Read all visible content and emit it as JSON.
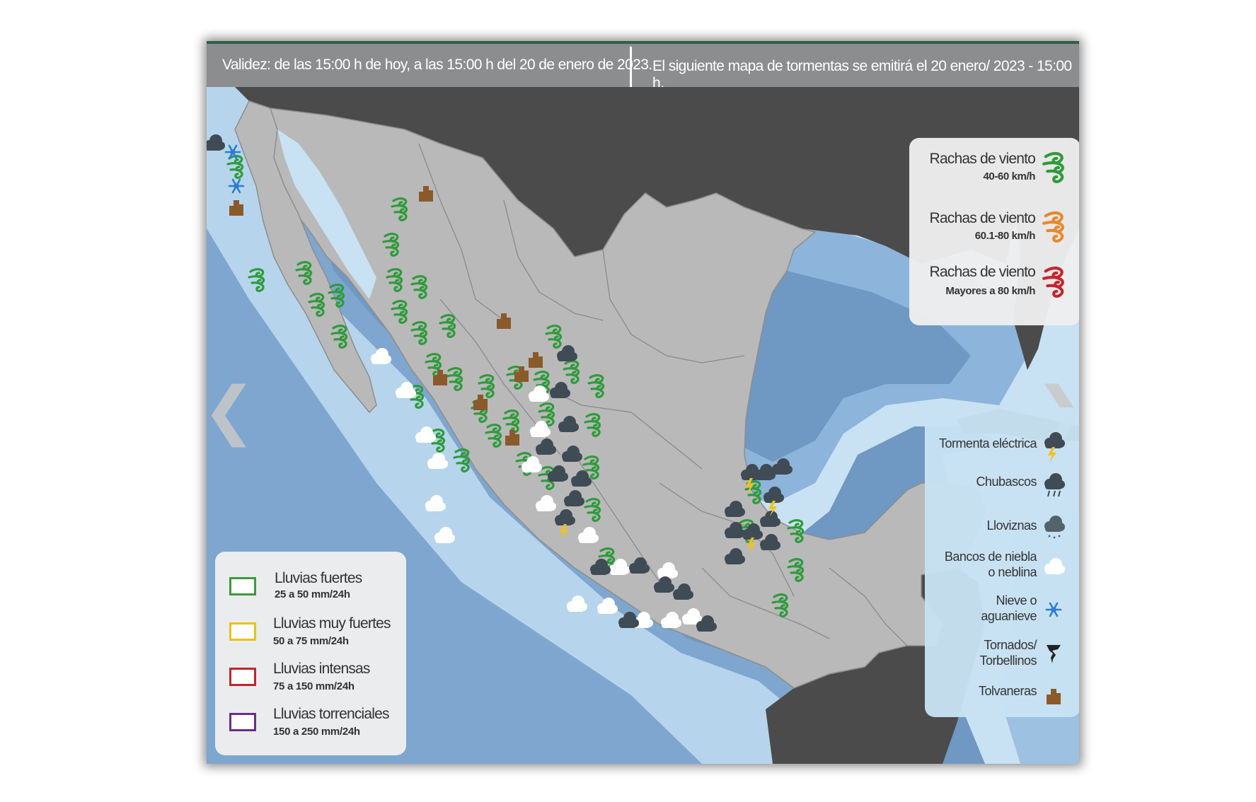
{
  "header": {
    "validity": "Validez: de las 15:00 h de hoy, a las 15:00 h del 20 de enero de 2023.",
    "next_map": "El siguiente mapa de tormentas se emitirá el 20 enero/ 2023 - 15:00 h."
  },
  "wind_legend": [
    {
      "title": "Rachas de viento",
      "range": "40-60 km/h",
      "color": "#2e9b3a"
    },
    {
      "title": "Rachas de viento",
      "range": "60.1-80 km/h",
      "color": "#e58a2e"
    },
    {
      "title": "Rachas de viento",
      "range": "Mayores a 80 km/h",
      "color": "#c4262e"
    }
  ],
  "rain_legend": [
    {
      "title": "Lluvias fuertes",
      "range": "25 a 50 mm/24h",
      "color": "#3c9a3c"
    },
    {
      "title": "Lluvias muy fuertes",
      "range": "50 a 75 mm/24h",
      "color": "#e8c21e"
    },
    {
      "title": "Lluvias intensas",
      "range": "75 a 150 mm/24h",
      "color": "#c0262b"
    },
    {
      "title": "Lluvias torrenciales",
      "range": "150 a 250 mm/24h",
      "color": "#6b2d8c"
    }
  ],
  "phenomena_legend": [
    {
      "label": "Tormenta eléctrica",
      "icon": "thunderstorm-icon"
    },
    {
      "label": "Chubascos",
      "icon": "showers-icon"
    },
    {
      "label": "Lloviznas",
      "icon": "drizzle-icon"
    },
    {
      "label": "Bancos de niebla o neblina",
      "label_line1": "Bancos de niebla",
      "label_line2": "o neblina",
      "icon": "fog-icon"
    },
    {
      "label": "Nieve o aguanieve",
      "label_line1": "Nieve o",
      "label_line2": "aguanieve",
      "icon": "snow-icon"
    },
    {
      "label": "Tornados/ Torbellinos",
      "label_line1": "Tornados/",
      "label_line2": "Torbellinos",
      "icon": "tornado-icon"
    },
    {
      "label": "Tolvaneras",
      "icon": "dust-storm-icon"
    }
  ],
  "navigation": {
    "prev": "❮",
    "next": "❯"
  },
  "colors": {
    "ocean_deep": "#6f98c3",
    "ocean_mid": "#9cc1e1",
    "ocean_shelf": "#c8e2f3",
    "land_mexico": "#b9b9b9",
    "land_other": "#4b4b4c",
    "wind_green": "#2e9b3a",
    "dust_brown": "#8a5a2b"
  }
}
